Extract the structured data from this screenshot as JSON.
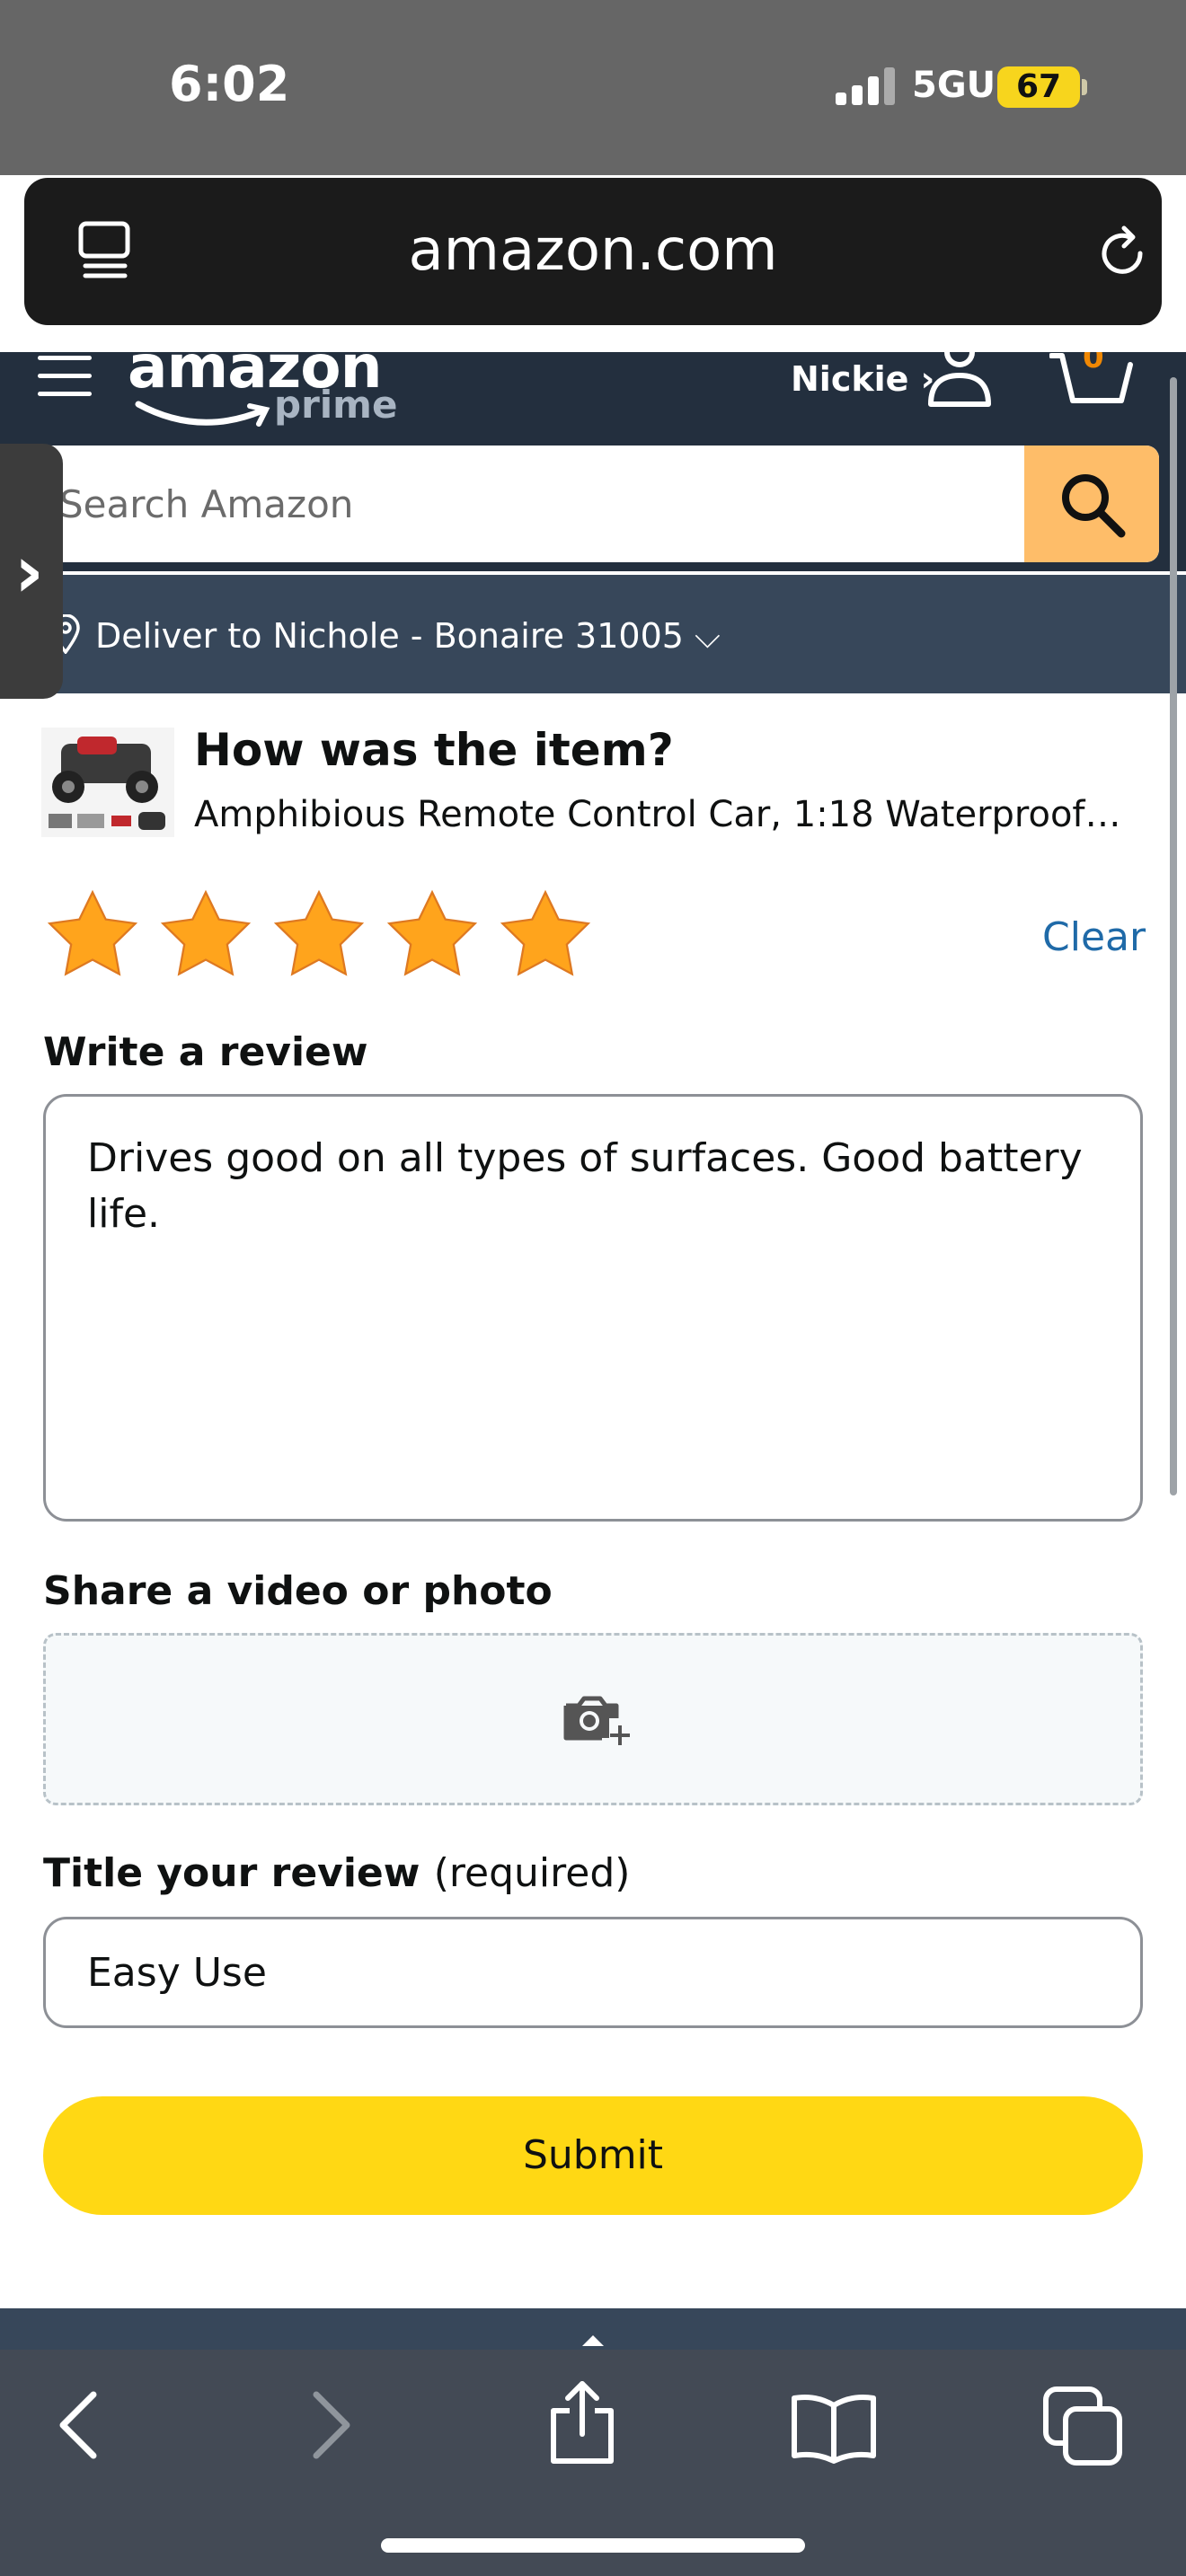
{
  "status_bar": {
    "time": "6:02",
    "network": "5GUC",
    "battery": "67"
  },
  "browser": {
    "url": "amazon.com"
  },
  "header": {
    "logo": "amazon",
    "logo_sub": "prime",
    "account_label": "Nickie ›",
    "cart_count": "0",
    "search_placeholder": "Search Amazon",
    "deliver_to": "Deliver to Nichole - Bonaire 31005 ⌵"
  },
  "review": {
    "heading": "How was the item?",
    "product_name": "Amphibious Remote Control Car, 1:18 Waterproof M...",
    "rating": 5,
    "rating_max": 5,
    "star_color": "#ffa41c",
    "clear_label": "Clear",
    "write_label": "Write a review",
    "review_text": "Drives good on all types of surfaces. Good battery life.",
    "media_label": "Share a video or photo",
    "title_label": "Title your review",
    "title_required": "(required)",
    "title_value": "Easy Use",
    "submit_label": "Submit"
  },
  "colors": {
    "header_bg": "#232f3e",
    "deliver_bg": "#37475a",
    "search_button": "#febd69",
    "submit_button": "#ffd814",
    "link": "#1f6aa8"
  },
  "toolbar": {
    "icons": [
      "back-icon",
      "forward-icon",
      "share-icon",
      "bookmarks-icon",
      "tabs-icon"
    ]
  }
}
